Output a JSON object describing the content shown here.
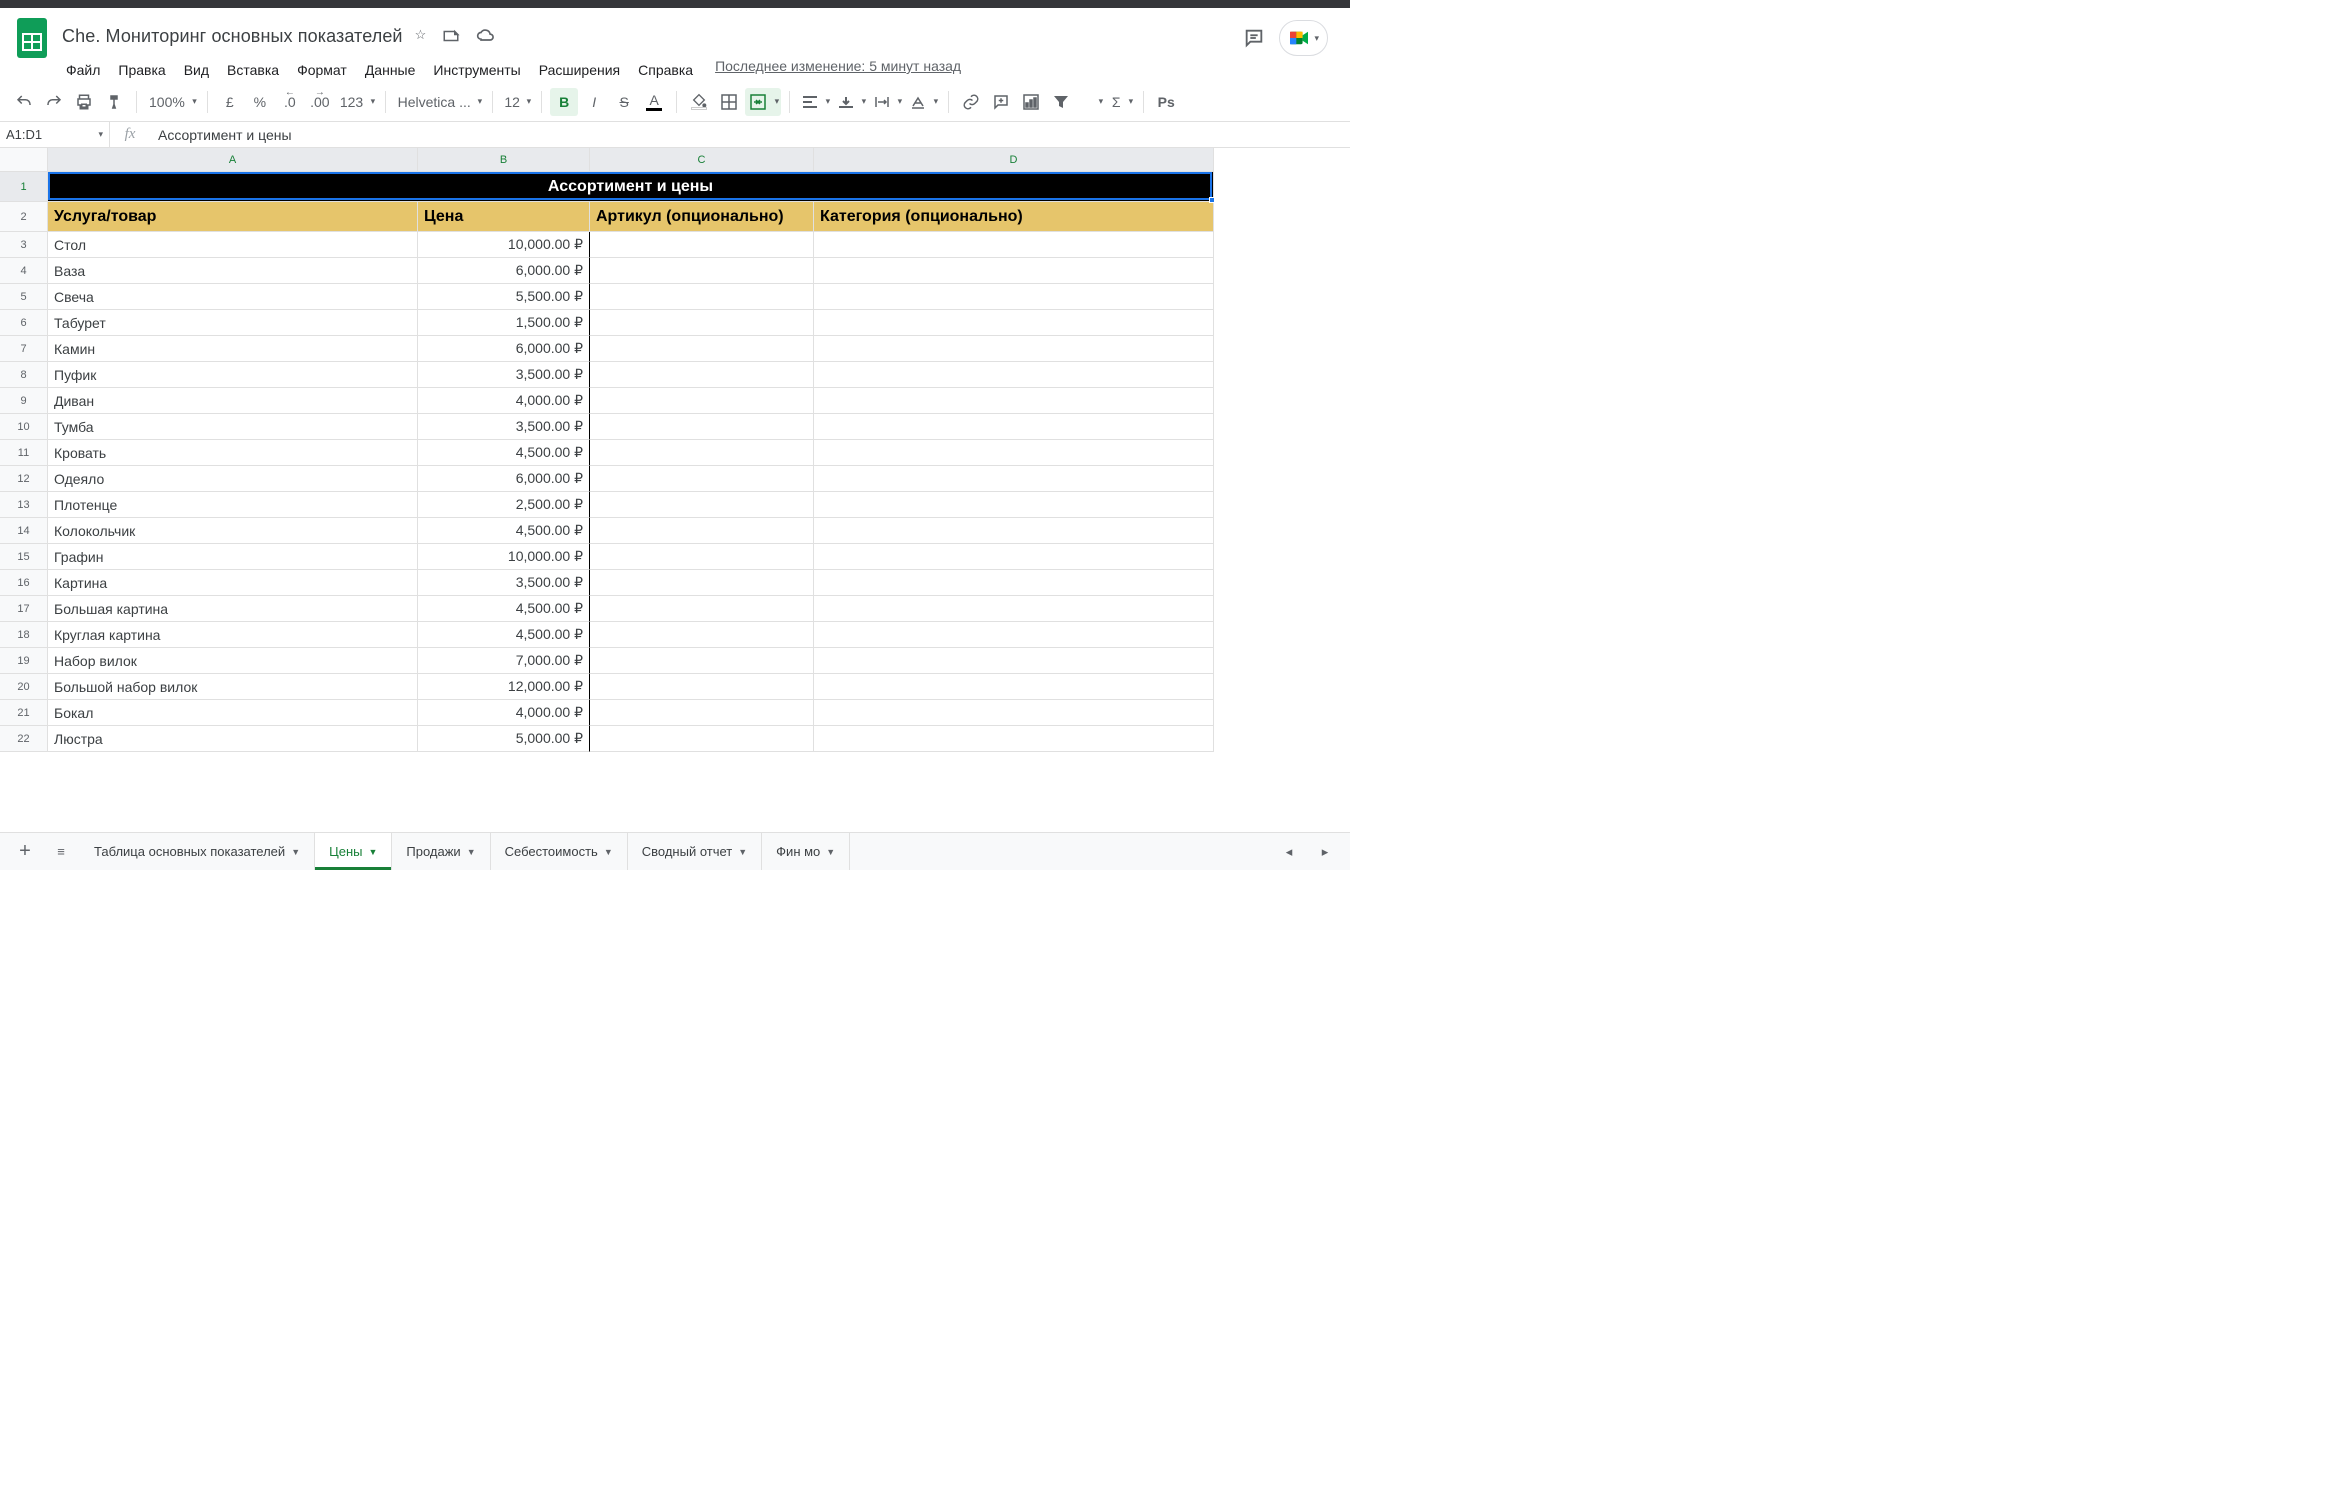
{
  "doc": {
    "title": "Che. Мониторинг основных показателей",
    "last_edit": "Последнее изменение: 5 минут назад"
  },
  "menu": [
    "Файл",
    "Правка",
    "Вид",
    "Вставка",
    "Формат",
    "Данные",
    "Инструменты",
    "Расширения",
    "Справка"
  ],
  "toolbar": {
    "zoom": "100%",
    "currency": "£",
    "percent": "%",
    "dec_dec": ".0",
    "dec_inc": ".00",
    "num_fmt": "123",
    "font": "Helvetica ...",
    "font_size": "12",
    "more": "Рs"
  },
  "name_box": "A1:D1",
  "formula": "Ассортимент и цены",
  "columns": {
    "A": "A",
    "B": "B",
    "C": "C",
    "D": "D"
  },
  "table": {
    "title": "Ассортимент и цены",
    "headers": {
      "A": "Услуга/товар",
      "B": "Цена",
      "C": "Артикул (опционально)",
      "D": "Категория (опционально)"
    },
    "rows": [
      {
        "name": "Стол",
        "price": "10,000.00 ₽"
      },
      {
        "name": "Ваза",
        "price": "6,000.00 ₽"
      },
      {
        "name": "Свеча",
        "price": "5,500.00 ₽"
      },
      {
        "name": "Табурет",
        "price": "1,500.00 ₽"
      },
      {
        "name": "Камин",
        "price": "6,000.00 ₽"
      },
      {
        "name": "Пуфик",
        "price": "3,500.00 ₽"
      },
      {
        "name": "Диван",
        "price": "4,000.00 ₽"
      },
      {
        "name": "Тумба",
        "price": "3,500.00 ₽"
      },
      {
        "name": "Кровать",
        "price": "4,500.00 ₽"
      },
      {
        "name": "Одеяло",
        "price": "6,000.00 ₽"
      },
      {
        "name": "Плотенце",
        "price": "2,500.00 ₽"
      },
      {
        "name": "Колокольчик",
        "price": "4,500.00 ₽"
      },
      {
        "name": "Графин",
        "price": "10,000.00 ₽"
      },
      {
        "name": "Картина",
        "price": "3,500.00 ₽"
      },
      {
        "name": "Большая картина",
        "price": "4,500.00 ₽"
      },
      {
        "name": "Круглая картина",
        "price": "4,500.00 ₽"
      },
      {
        "name": "Набор вилок",
        "price": "7,000.00 ₽"
      },
      {
        "name": "Большой набор вилок",
        "price": "12,000.00 ₽"
      },
      {
        "name": "Бокал",
        "price": "4,000.00 ₽"
      },
      {
        "name": "Люстра",
        "price": "5,000.00 ₽"
      }
    ]
  },
  "sheets": {
    "items": [
      {
        "label": "Таблица основных показателей",
        "active": false
      },
      {
        "label": "Цены",
        "active": true
      },
      {
        "label": "Продажи",
        "active": false
      },
      {
        "label": "Себестоимость",
        "active": false
      },
      {
        "label": "Сводный отчет",
        "active": false
      },
      {
        "label": "Фин мо",
        "active": false
      }
    ]
  }
}
